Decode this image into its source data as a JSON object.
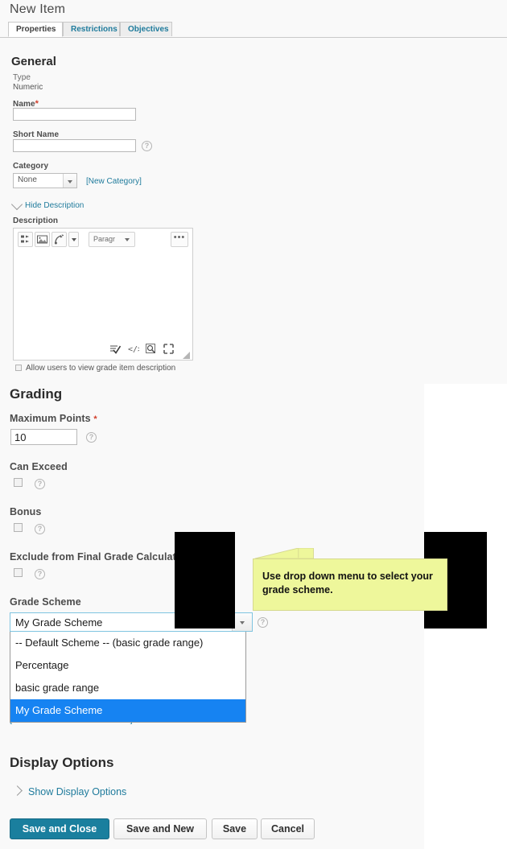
{
  "page": {
    "title": "New Item"
  },
  "tabs": [
    {
      "label": "Properties",
      "active": true
    },
    {
      "label": "Restrictions",
      "active": false
    },
    {
      "label": "Objectives",
      "active": false
    }
  ],
  "general": {
    "heading": "General",
    "type_label": "Type",
    "type_value": "Numeric",
    "name_label": "Name",
    "name_required_marker": "*",
    "name_value": "",
    "short_name_label": "Short Name",
    "short_name_value": "",
    "short_name_help": "?",
    "category_label": "Category",
    "category_value": "None",
    "new_category_link": "[New Category]",
    "hide_description_link": "Hide Description",
    "description_label": "Description",
    "allow_users_checkbox_label": "Allow users to view grade item description"
  },
  "editor": {
    "paragraph_style": "Paragr",
    "more_button": "•••",
    "toolbar_icons": [
      "insert-stuff-icon",
      "insert-image-icon",
      "quicklink-icon",
      "chevron-down-icon"
    ],
    "footer_icons": [
      "spellcheck-icon",
      "html-source-icon",
      "preview-icon",
      "fullscreen-icon",
      "resize-grip-icon"
    ],
    "content": ""
  },
  "grading": {
    "heading": "Grading",
    "max_points_label": "Maximum Points",
    "max_points_required_marker": "*",
    "max_points_value": "10",
    "can_exceed_label": "Can Exceed",
    "can_exceed_checked": false,
    "bonus_label": "Bonus",
    "bonus_checked": false,
    "exclude_label": "Exclude from Final Grade Calculation",
    "exclude_checked": false,
    "grade_scheme_label": "Grade Scheme",
    "grade_scheme_value": "My Grade Scheme",
    "grade_scheme_options": [
      "-- Default Scheme -- (basic grade range)",
      "Percentage",
      "basic grade range",
      "My Grade Scheme"
    ],
    "grade_scheme_selected_index": 3,
    "rubric_link": "[Create Rubric in New Window]"
  },
  "display_options": {
    "heading": "Display Options",
    "show_link": "Show Display Options"
  },
  "footer_buttons": [
    {
      "label": "Save and Close",
      "primary": true
    },
    {
      "label": "Save and New",
      "primary": false
    },
    {
      "label": "Save",
      "primary": false
    },
    {
      "label": "Cancel",
      "primary": false
    }
  ],
  "callout": {
    "text": "Use drop down menu to select your grade scheme."
  },
  "colors": {
    "accent_teal": "#1a7f9e",
    "link_blue": "#1f7b9c",
    "selection_blue": "#1683f2",
    "note_yellow": "#eef79b",
    "required_red": "#d13e2b",
    "page_gray": "#f9f9f9"
  }
}
